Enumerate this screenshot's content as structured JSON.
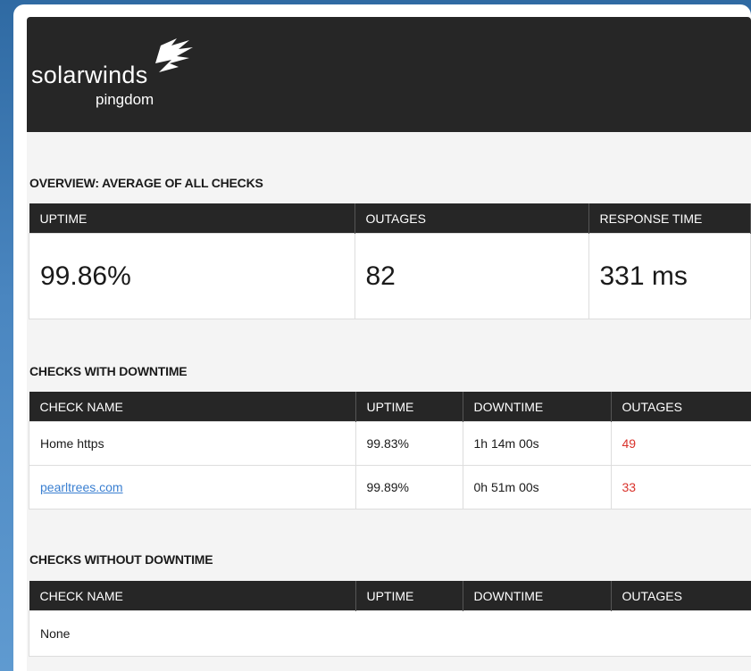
{
  "brand": {
    "name": "solarwinds",
    "product": "pingdom"
  },
  "overview": {
    "title": "OVERVIEW: AVERAGE OF ALL CHECKS",
    "headers": [
      "UPTIME",
      "OUTAGES",
      "RESPONSE TIME"
    ],
    "values": [
      "99.86%",
      "82",
      "331 ms"
    ]
  },
  "with_downtime": {
    "title": "CHECKS WITH DOWNTIME",
    "headers": [
      "CHECK NAME",
      "UPTIME",
      "DOWNTIME",
      "OUTAGES"
    ],
    "rows": [
      {
        "name": "Home https",
        "uptime": "99.83%",
        "downtime": "1h 14m 00s",
        "outages": "49"
      },
      {
        "name": "pearltrees.com",
        "uptime": "99.89%",
        "downtime": "0h 51m 00s",
        "outages": "33"
      }
    ]
  },
  "without_downtime": {
    "title": "CHECKS WITHOUT DOWNTIME",
    "headers": [
      "CHECK NAME",
      "UPTIME",
      "DOWNTIME",
      "OUTAGES"
    ],
    "empty_text": "None"
  },
  "colors": {
    "header_bg": "#262626",
    "outage_red": "#d9322b",
    "link_blue": "#3a7fd1"
  }
}
